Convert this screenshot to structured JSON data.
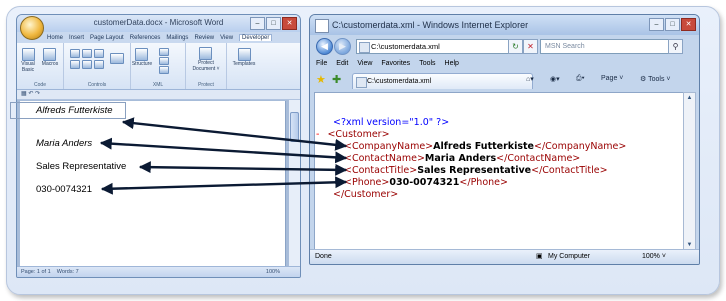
{
  "word": {
    "title": "customerData.docx - Microsoft Word",
    "tabs": [
      "Home",
      "Insert",
      "Page Layout",
      "References",
      "Mailings",
      "Review",
      "View",
      "Developer"
    ],
    "ribbon": {
      "visual_basic": "Visual Basic",
      "macros": "Macros",
      "code_group": "Code",
      "controls_group": "Controls",
      "structure": "Structure",
      "xml_group": "XML",
      "protect_document": "Protect Document ˅",
      "protect_group": "Protect",
      "templates": "Templates"
    },
    "document_lines": [
      "Alfreds Futterkiste",
      "Maria Anders",
      "Sales Representative",
      "030-0074321"
    ],
    "status": {
      "page": "Page: 1 of 1",
      "words": "Words: 7",
      "zoom": "100%"
    }
  },
  "ie": {
    "title": "C:\\customerdata.xml - Windows Internet Explorer",
    "address": "C:\\customerdata.xml",
    "search_placeholder": "MSN Search",
    "menu": [
      "File",
      "Edit",
      "View",
      "Favorites",
      "Tools",
      "Help"
    ],
    "tab_label": "C:\\customerdata.xml",
    "toolbar": {
      "page": "Page ˅",
      "tools": "Tools ˅"
    },
    "status": {
      "left": "Done",
      "zone": "My Computer",
      "zoom": "100% ˅"
    }
  },
  "xml_doc": {
    "declaration": "<?xml version=\"1.0\" ?>",
    "root_open": "<Customer>",
    "root_close": "</Customer>",
    "collapse_marker": "-",
    "elements": [
      {
        "open": "<CompanyName>",
        "value": "Alfreds Futterkiste",
        "close": "</CompanyName>"
      },
      {
        "open": "<ContactName>",
        "value": "Maria Anders",
        "close": "</ContactName>"
      },
      {
        "open": "<ContactTitle>",
        "value": "Sales Representative",
        "close": "</ContactTitle>"
      },
      {
        "open": "<Phone>",
        "value": "030-0074321",
        "close": "</Phone>"
      }
    ]
  },
  "colors": {
    "xml_tag": "#990000",
    "xml_bracket": "#0000ff",
    "arrow": "#0b1a33"
  }
}
